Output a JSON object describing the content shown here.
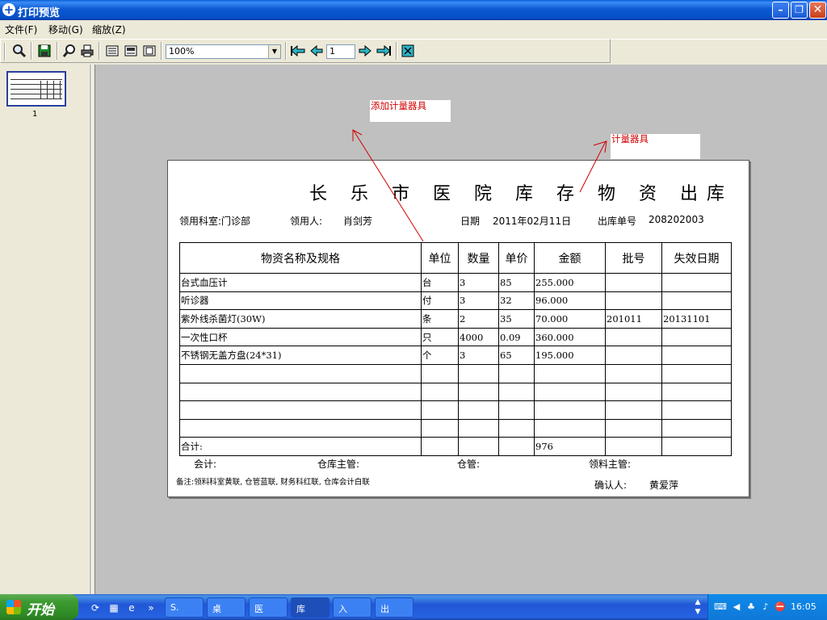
{
  "window": {
    "title": "打印预览",
    "minimize": "–",
    "restore": "❐",
    "close": "✕"
  },
  "menu": {
    "items": [
      "文件(F)",
      "移动(G)",
      "缩放(Z)"
    ]
  },
  "toolbar": {
    "zoom_value": "100%",
    "page_value": "1",
    "icons": [
      "search-icon",
      "save-icon",
      "zoom-icon",
      "print-icon",
      "single-page-icon",
      "page-setup-icon",
      "fit-page-icon",
      "first-page-icon",
      "previous-page-icon",
      "next-page-icon",
      "last-page-icon",
      "exit-icon"
    ]
  },
  "thumbnails": {
    "page_label": "1"
  },
  "annotations": {
    "add_instrument": "添加计量器具",
    "instrument": "计量器具"
  },
  "document": {
    "title": "长 乐 市 医 院 库 存 物 资 出库",
    "department_label": "领用科室:门诊部",
    "recipient_label": "领用人:",
    "recipient_value": "肖剑芳",
    "date_label": "日期",
    "date_value": "2011年02月11日",
    "order_label": "出库单号",
    "order_value": "208202003",
    "columns": [
      "物资名称及规格",
      "单位",
      "数量",
      "单价",
      "金额",
      "批号",
      "失效日期"
    ],
    "rows": [
      [
        "台式血压计",
        "台",
        "3",
        "85",
        "255.000",
        "",
        ""
      ],
      [
        "听诊器",
        "付",
        "3",
        "32",
        "96.000",
        "",
        ""
      ],
      [
        "紫外线杀菌灯(30W)",
        "条",
        "2",
        "35",
        "70.000",
        "201011",
        "20131101"
      ],
      [
        "一次性口杯",
        "只",
        "4000",
        "0.09",
        "360.000",
        "",
        ""
      ],
      [
        "不锈钢无盖方盘(24*31)",
        "个",
        "3",
        "65",
        "195.000",
        "",
        ""
      ],
      [
        "",
        "",
        "",
        "",
        "",
        "",
        ""
      ],
      [
        "",
        "",
        "",
        "",
        "",
        "",
        ""
      ],
      [
        "",
        "",
        "",
        "",
        "",
        "",
        ""
      ],
      [
        "",
        "",
        "",
        "",
        "",
        "",
        ""
      ]
    ],
    "total_label": "合计:",
    "total_value": "976",
    "accountant_label": "会计:",
    "warehouse_supervisor_label": "仓库主管:",
    "warehouse_keeper_label": "仓管:",
    "dept_supervisor_label": "领料主管:",
    "note": "备注:领料科室黄联, 仓管蓝联, 财务科红联, 仓库会计白联",
    "confirmer_label": "确认人:",
    "confirmer_value": "黄爱萍"
  },
  "taskbar": {
    "start_label": "开始",
    "tasks": [
      "S.",
      "桌",
      "医",
      "库",
      "入",
      "出"
    ],
    "clock": "16:05"
  },
  "colors": {
    "annotation": "#d00000",
    "titlebar": "#0b58d2",
    "taskbar": "#2157d7",
    "start": "#3c9a30",
    "preview_bg": "#c0c0c0"
  }
}
